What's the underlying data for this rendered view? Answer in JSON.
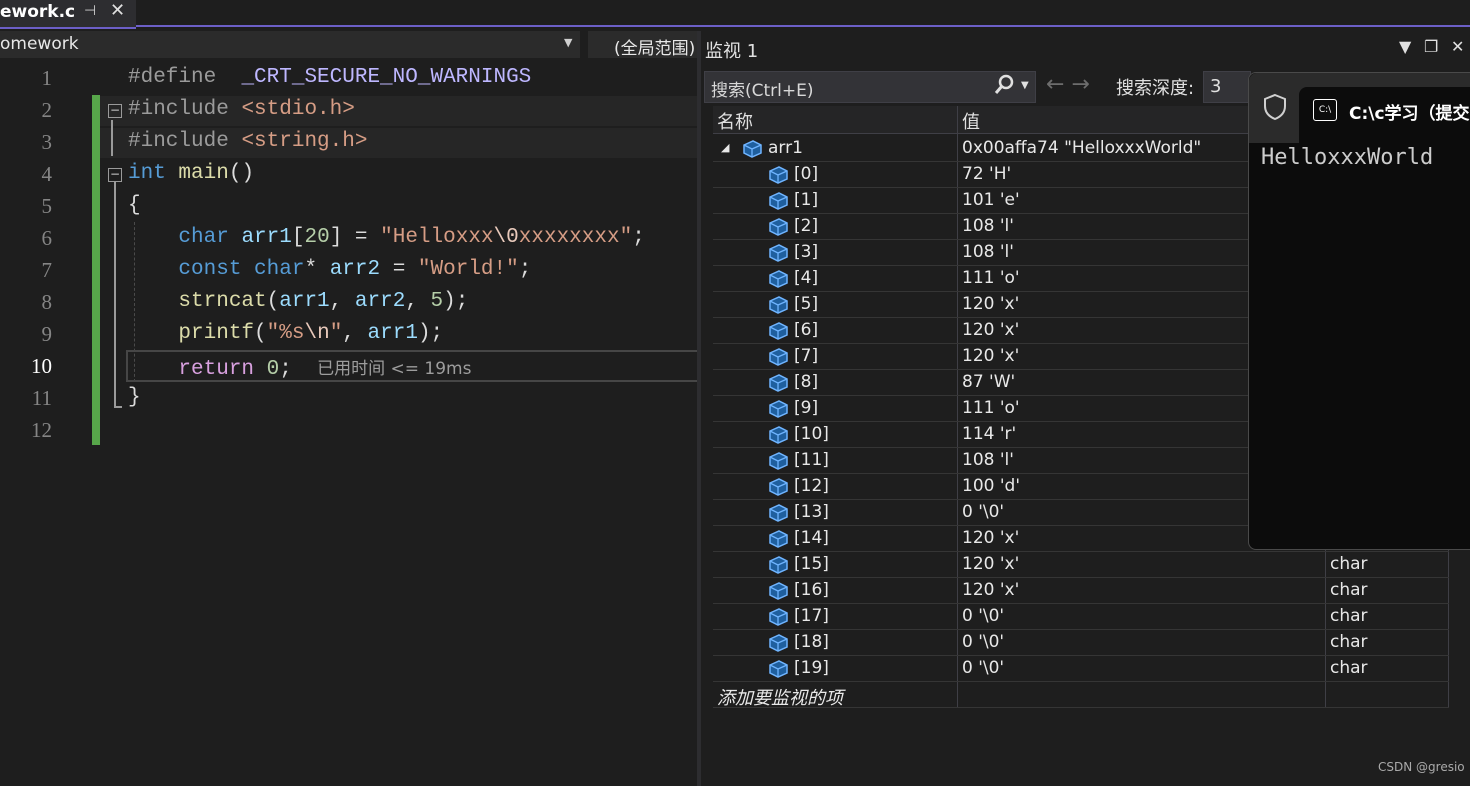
{
  "editor": {
    "tab_name": "ework.c",
    "tab_pin": "⊣",
    "tab_close": "✕",
    "nav_project": "omework",
    "nav_scope": "(全局范围)",
    "line_numbers": [
      "1",
      "2",
      "3",
      "4",
      "5",
      "6",
      "7",
      "8",
      "9",
      "10",
      "11",
      "12"
    ],
    "current_line": "10",
    "code": {
      "l1_kw": "#define",
      "l1_macro": "_CRT_SECURE_NO_WARNINGS",
      "l2_kw": "#include",
      "l2_hdr": "<stdio.h>",
      "l3_kw": "#include",
      "l3_hdr": "<string.h>",
      "l4_type": "int",
      "l4_fn": "main",
      "l4_paren": "()",
      "l5": "{",
      "l6_type": "char",
      "l6_var": "arr1",
      "l6_idx": "[",
      "l6_num": "20",
      "l6_rest": "] = ",
      "l6_str1": "\"Helloxxx",
      "l6_esc": "\\0",
      "l6_str2": "xxxxxxxx\"",
      "l6_end": ";",
      "l7_kw": "const",
      "l7_type": "char",
      "l7_star": "* ",
      "l7_var": "arr2",
      "l7_eq": " = ",
      "l7_str": "\"World!\"",
      "l7_end": ";",
      "l8_fn": "strncat",
      "l8_open": "(",
      "l8_a1": "arr1",
      "l8_c1": ", ",
      "l8_a2": "arr2",
      "l8_c2": ", ",
      "l8_num": "5",
      "l8_end": ");",
      "l9_fn": "printf",
      "l9_open": "(",
      "l9_str1": "\"%s",
      "l9_esc": "\\n",
      "l9_str2": "\"",
      "l9_c": ", ",
      "l9_a": "arr1",
      "l9_end": ");",
      "l10_kw": "return",
      "l10_num": "0",
      "l10_end": ";",
      "l10_hint": "已用时间 <= 19ms",
      "l11": "}"
    }
  },
  "watch": {
    "title": "监视 1",
    "controls": [
      "▼",
      "❐",
      "✕"
    ],
    "search_placeholder": "搜索(Ctrl+E)",
    "search_icon": "search-icon",
    "nav_arrows": "←  →",
    "depth_label": "搜索深度:",
    "depth_value": "3",
    "col_name": "名称",
    "col_value": "值",
    "root": {
      "name": "arr1",
      "value": "0x00affa74 \"HelloxxxWorld\"",
      "expanded_glyph": "◢"
    },
    "items": [
      {
        "name": "[0]",
        "value": "72 'H'",
        "type": ""
      },
      {
        "name": "[1]",
        "value": "101 'e'",
        "type": ""
      },
      {
        "name": "[2]",
        "value": "108 'l'",
        "type": ""
      },
      {
        "name": "[3]",
        "value": "108 'l'",
        "type": ""
      },
      {
        "name": "[4]",
        "value": "111 'o'",
        "type": ""
      },
      {
        "name": "[5]",
        "value": "120 'x'",
        "type": ""
      },
      {
        "name": "[6]",
        "value": "120 'x'",
        "type": ""
      },
      {
        "name": "[7]",
        "value": "120 'x'",
        "type": ""
      },
      {
        "name": "[8]",
        "value": "87 'W'",
        "type": ""
      },
      {
        "name": "[9]",
        "value": "111 'o'",
        "type": ""
      },
      {
        "name": "[10]",
        "value": "114 'r'",
        "type": ""
      },
      {
        "name": "[11]",
        "value": "108 'l'",
        "type": ""
      },
      {
        "name": "[12]",
        "value": "100 'd'",
        "type": ""
      },
      {
        "name": "[13]",
        "value": "0 '\\0'",
        "type": ""
      },
      {
        "name": "[14]",
        "value": "120 'x'",
        "type": ""
      },
      {
        "name": "[15]",
        "value": "120 'x'",
        "type": "char"
      },
      {
        "name": "[16]",
        "value": "120 'x'",
        "type": "char"
      },
      {
        "name": "[17]",
        "value": "0 '\\0'",
        "type": "char"
      },
      {
        "name": "[18]",
        "value": "0 '\\0'",
        "type": "char"
      },
      {
        "name": "[19]",
        "value": "0 '\\0'",
        "type": "char"
      }
    ],
    "add_item": "添加要监视的项"
  },
  "console": {
    "title": "C:\\c学习（提交",
    "icon_text": "C:\\",
    "output": "HelloxxxWorld"
  },
  "watermark": "CSDN @gresio"
}
